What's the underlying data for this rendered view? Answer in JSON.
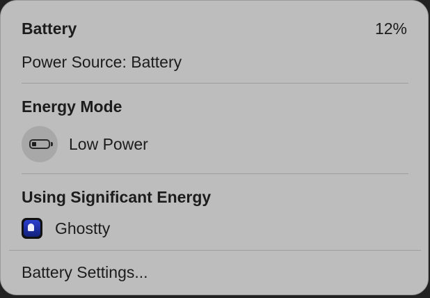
{
  "header": {
    "title": "Battery",
    "percent": "12%",
    "power_source": "Power Source: Battery"
  },
  "energy_mode": {
    "title": "Energy Mode",
    "option_label": "Low Power",
    "option_icon": "battery-low-icon"
  },
  "significant_energy": {
    "title": "Using Significant Energy",
    "apps": [
      {
        "name": "Ghostty",
        "icon": "ghostty-app-icon"
      }
    ]
  },
  "footer": {
    "settings_label": "Battery Settings..."
  },
  "colors": {
    "menu_background": "#bdbdbd",
    "text": "#1c1c1c",
    "divider": "#9d9d9d"
  }
}
